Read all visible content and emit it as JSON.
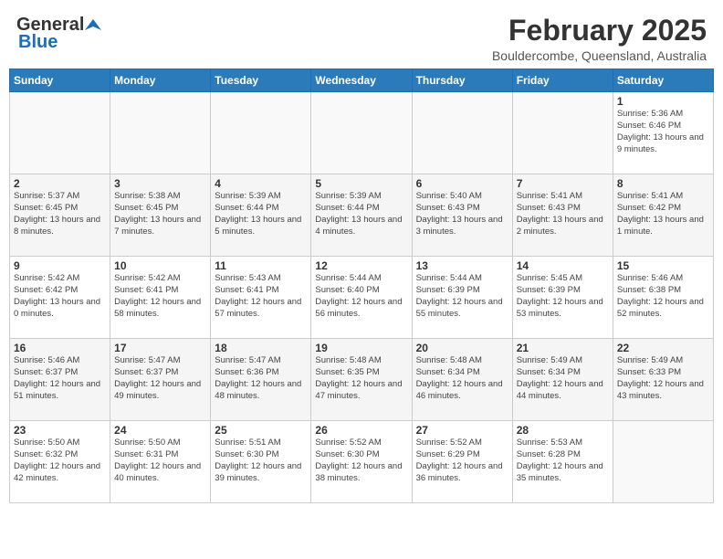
{
  "header": {
    "logo_general": "General",
    "logo_blue": "Blue",
    "title": "February 2025",
    "location": "Bouldercombe, Queensland, Australia"
  },
  "weekdays": [
    "Sunday",
    "Monday",
    "Tuesday",
    "Wednesday",
    "Thursday",
    "Friday",
    "Saturday"
  ],
  "weeks": [
    [
      {
        "day": "",
        "info": ""
      },
      {
        "day": "",
        "info": ""
      },
      {
        "day": "",
        "info": ""
      },
      {
        "day": "",
        "info": ""
      },
      {
        "day": "",
        "info": ""
      },
      {
        "day": "",
        "info": ""
      },
      {
        "day": "1",
        "info": "Sunrise: 5:36 AM\nSunset: 6:46 PM\nDaylight: 13 hours and 9 minutes."
      }
    ],
    [
      {
        "day": "2",
        "info": "Sunrise: 5:37 AM\nSunset: 6:45 PM\nDaylight: 13 hours and 8 minutes."
      },
      {
        "day": "3",
        "info": "Sunrise: 5:38 AM\nSunset: 6:45 PM\nDaylight: 13 hours and 7 minutes."
      },
      {
        "day": "4",
        "info": "Sunrise: 5:39 AM\nSunset: 6:44 PM\nDaylight: 13 hours and 5 minutes."
      },
      {
        "day": "5",
        "info": "Sunrise: 5:39 AM\nSunset: 6:44 PM\nDaylight: 13 hours and 4 minutes."
      },
      {
        "day": "6",
        "info": "Sunrise: 5:40 AM\nSunset: 6:43 PM\nDaylight: 13 hours and 3 minutes."
      },
      {
        "day": "7",
        "info": "Sunrise: 5:41 AM\nSunset: 6:43 PM\nDaylight: 13 hours and 2 minutes."
      },
      {
        "day": "8",
        "info": "Sunrise: 5:41 AM\nSunset: 6:42 PM\nDaylight: 13 hours and 1 minute."
      }
    ],
    [
      {
        "day": "9",
        "info": "Sunrise: 5:42 AM\nSunset: 6:42 PM\nDaylight: 13 hours and 0 minutes."
      },
      {
        "day": "10",
        "info": "Sunrise: 5:42 AM\nSunset: 6:41 PM\nDaylight: 12 hours and 58 minutes."
      },
      {
        "day": "11",
        "info": "Sunrise: 5:43 AM\nSunset: 6:41 PM\nDaylight: 12 hours and 57 minutes."
      },
      {
        "day": "12",
        "info": "Sunrise: 5:44 AM\nSunset: 6:40 PM\nDaylight: 12 hours and 56 minutes."
      },
      {
        "day": "13",
        "info": "Sunrise: 5:44 AM\nSunset: 6:39 PM\nDaylight: 12 hours and 55 minutes."
      },
      {
        "day": "14",
        "info": "Sunrise: 5:45 AM\nSunset: 6:39 PM\nDaylight: 12 hours and 53 minutes."
      },
      {
        "day": "15",
        "info": "Sunrise: 5:46 AM\nSunset: 6:38 PM\nDaylight: 12 hours and 52 minutes."
      }
    ],
    [
      {
        "day": "16",
        "info": "Sunrise: 5:46 AM\nSunset: 6:37 PM\nDaylight: 12 hours and 51 minutes."
      },
      {
        "day": "17",
        "info": "Sunrise: 5:47 AM\nSunset: 6:37 PM\nDaylight: 12 hours and 49 minutes."
      },
      {
        "day": "18",
        "info": "Sunrise: 5:47 AM\nSunset: 6:36 PM\nDaylight: 12 hours and 48 minutes."
      },
      {
        "day": "19",
        "info": "Sunrise: 5:48 AM\nSunset: 6:35 PM\nDaylight: 12 hours and 47 minutes."
      },
      {
        "day": "20",
        "info": "Sunrise: 5:48 AM\nSunset: 6:34 PM\nDaylight: 12 hours and 46 minutes."
      },
      {
        "day": "21",
        "info": "Sunrise: 5:49 AM\nSunset: 6:34 PM\nDaylight: 12 hours and 44 minutes."
      },
      {
        "day": "22",
        "info": "Sunrise: 5:49 AM\nSunset: 6:33 PM\nDaylight: 12 hours and 43 minutes."
      }
    ],
    [
      {
        "day": "23",
        "info": "Sunrise: 5:50 AM\nSunset: 6:32 PM\nDaylight: 12 hours and 42 minutes."
      },
      {
        "day": "24",
        "info": "Sunrise: 5:50 AM\nSunset: 6:31 PM\nDaylight: 12 hours and 40 minutes."
      },
      {
        "day": "25",
        "info": "Sunrise: 5:51 AM\nSunset: 6:30 PM\nDaylight: 12 hours and 39 minutes."
      },
      {
        "day": "26",
        "info": "Sunrise: 5:52 AM\nSunset: 6:30 PM\nDaylight: 12 hours and 38 minutes."
      },
      {
        "day": "27",
        "info": "Sunrise: 5:52 AM\nSunset: 6:29 PM\nDaylight: 12 hours and 36 minutes."
      },
      {
        "day": "28",
        "info": "Sunrise: 5:53 AM\nSunset: 6:28 PM\nDaylight: 12 hours and 35 minutes."
      },
      {
        "day": "",
        "info": ""
      }
    ]
  ]
}
